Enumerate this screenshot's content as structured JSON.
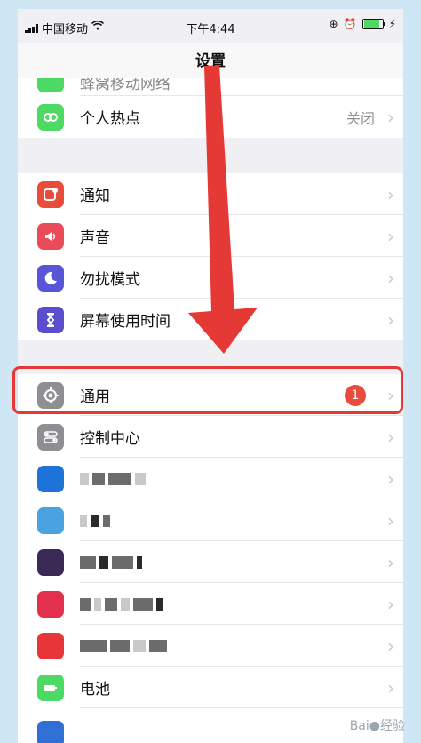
{
  "status_bar": {
    "carrier": "中国移动",
    "time": "下午4:44"
  },
  "nav": {
    "title": "设置"
  },
  "rows": [
    {
      "label": "蜂窝移动网络",
      "icon": "cellular-icon",
      "color": "#4cd964"
    },
    {
      "label": "个人热点",
      "detail": "关闭",
      "icon": "hotspot-icon",
      "color": "#4cd964"
    },
    {
      "label": "通知",
      "icon": "notification-icon",
      "color": "#e74c3c"
    },
    {
      "label": "声音",
      "icon": "sound-icon",
      "color": "#e94b5b"
    },
    {
      "label": "勿扰模式",
      "icon": "moon-icon",
      "color": "#5856d6"
    },
    {
      "label": "屏幕使用时间",
      "icon": "hourglass-icon",
      "color": "#5a4ecf"
    },
    {
      "label": "通用",
      "badge": "1",
      "icon": "gear-icon",
      "color": "#8e8e93"
    },
    {
      "label": "控制中心",
      "icon": "toggle-icon",
      "color": "#8e8e93"
    },
    {
      "label": "电池",
      "icon": "battery-icon",
      "color": "#4cd964"
    }
  ],
  "colors": {
    "highlight": "#e53935",
    "arrow": "#e53935",
    "badge": "#e74c3c"
  }
}
